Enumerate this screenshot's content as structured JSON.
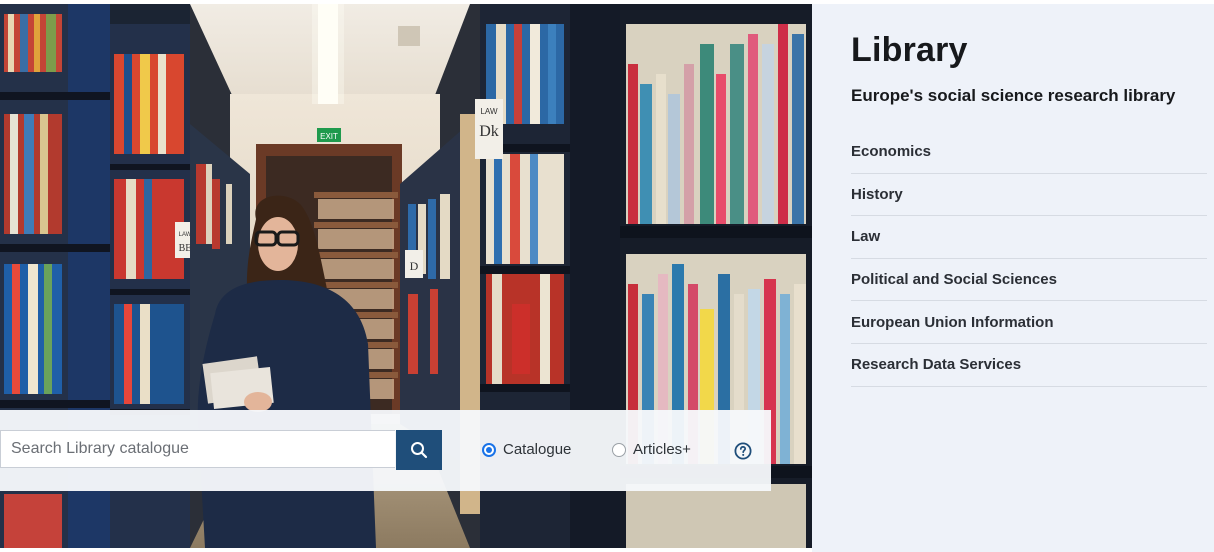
{
  "library": {
    "title": "Library",
    "subtitle": "Europe's social science research library",
    "nav": [
      {
        "label": "Economics"
      },
      {
        "label": "History"
      },
      {
        "label": "Law"
      },
      {
        "label": "Political and Social Sciences"
      },
      {
        "label": "European Union Information"
      },
      {
        "label": "Research Data Services"
      }
    ]
  },
  "search": {
    "placeholder": "Search Library catalogue",
    "value": "",
    "options": [
      {
        "label": "Catalogue",
        "selected": true
      },
      {
        "label": "Articles+",
        "selected": false
      }
    ],
    "help_icon": "question-circle-icon",
    "search_icon": "magnifier-icon"
  },
  "hero": {
    "shelf_labels": [
      "LAW",
      "Dk",
      "LAW",
      "BE",
      "D",
      "C"
    ],
    "exit_sign": "EXIT"
  },
  "colors": {
    "panel_bg": "#eef2f9",
    "search_button": "#1f4e7a",
    "radio_accent": "#1a73e8"
  }
}
